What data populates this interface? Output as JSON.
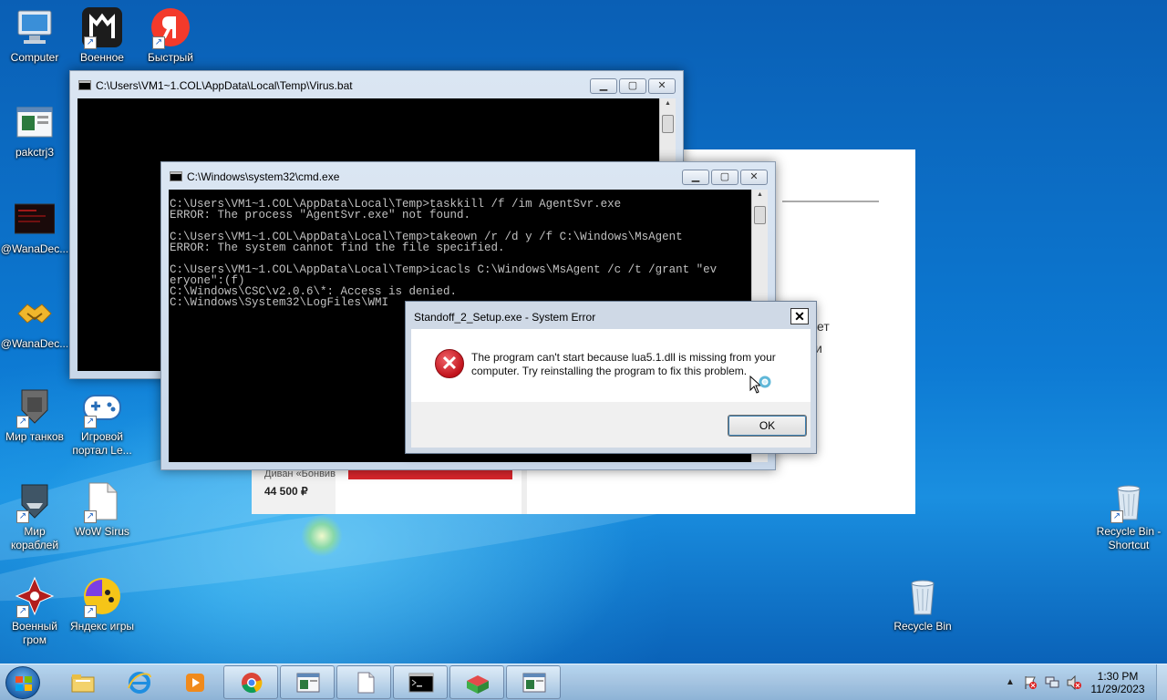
{
  "desktop_icons": {
    "computer": "Computer",
    "voennoe": "Военное",
    "bystry": "Быстрый",
    "pakctrj3": "pakctrj3",
    "wana1": "@WanaDec...",
    "wana2": "@WanaDec...",
    "mir_tankov": "Мир танков",
    "igrovoy": "Игровой портал Le...",
    "mir_korabley": "Мир кораблей",
    "wow_sirus": "WoW Sirus",
    "voenny_grom": "Военный гром",
    "yandex_igry": "Яндекс игры",
    "recycle_shortcut": "Recycle Bin - Shortcut",
    "recycle_bin": "Recycle Bin"
  },
  "browser": {
    "frag1": "ет",
    "frag2": "и",
    "product_name": "Диван «Бонвив",
    "product_price": "44 500 ₽"
  },
  "virus_window": {
    "title": "C:\\Users\\VM1~1.COL\\AppData\\Local\\Temp\\Virus.bat"
  },
  "cmd_window": {
    "title": "C:\\Windows\\system32\\cmd.exe",
    "lines": [
      "C:\\Users\\VM1~1.COL\\AppData\\Local\\Temp>taskkill /f /im AgentSvr.exe",
      "ERROR: The process \"AgentSvr.exe\" not found.",
      "",
      "C:\\Users\\VM1~1.COL\\AppData\\Local\\Temp>takeown /r /d y /f C:\\Windows\\MsAgent",
      "ERROR: The system cannot find the file specified.",
      "",
      "C:\\Users\\VM1~1.COL\\AppData\\Local\\Temp>icacls C:\\Windows\\MsAgent /c /t /grant \"ev",
      "eryone\":(f)",
      "C:\\Windows\\CSC\\v2.0.6\\*: Access is denied.",
      "C:\\Windows\\System32\\LogFiles\\WMI"
    ]
  },
  "window_controls": {
    "minimize": "▁",
    "maximize": "▢",
    "close": "✕"
  },
  "error_dialog": {
    "title": "Standoff_2_Setup.exe - System Error",
    "message": "The program can't start because lua5.1.dll is missing from your computer. Try reinstalling the program to fix this problem.",
    "ok_label": "OK",
    "close_label": "✕",
    "icon_glyph": "✕"
  },
  "taskbar": {
    "time": "1:30 PM",
    "date": "11/29/2023",
    "tray_arrow": "▲",
    "pinned": [
      "explorer-icon",
      "ie-icon",
      "media-player-icon",
      "chrome-icon",
      "window-icon",
      "document-icon",
      "cmd-icon",
      "installer-icon",
      "window-icon"
    ]
  }
}
